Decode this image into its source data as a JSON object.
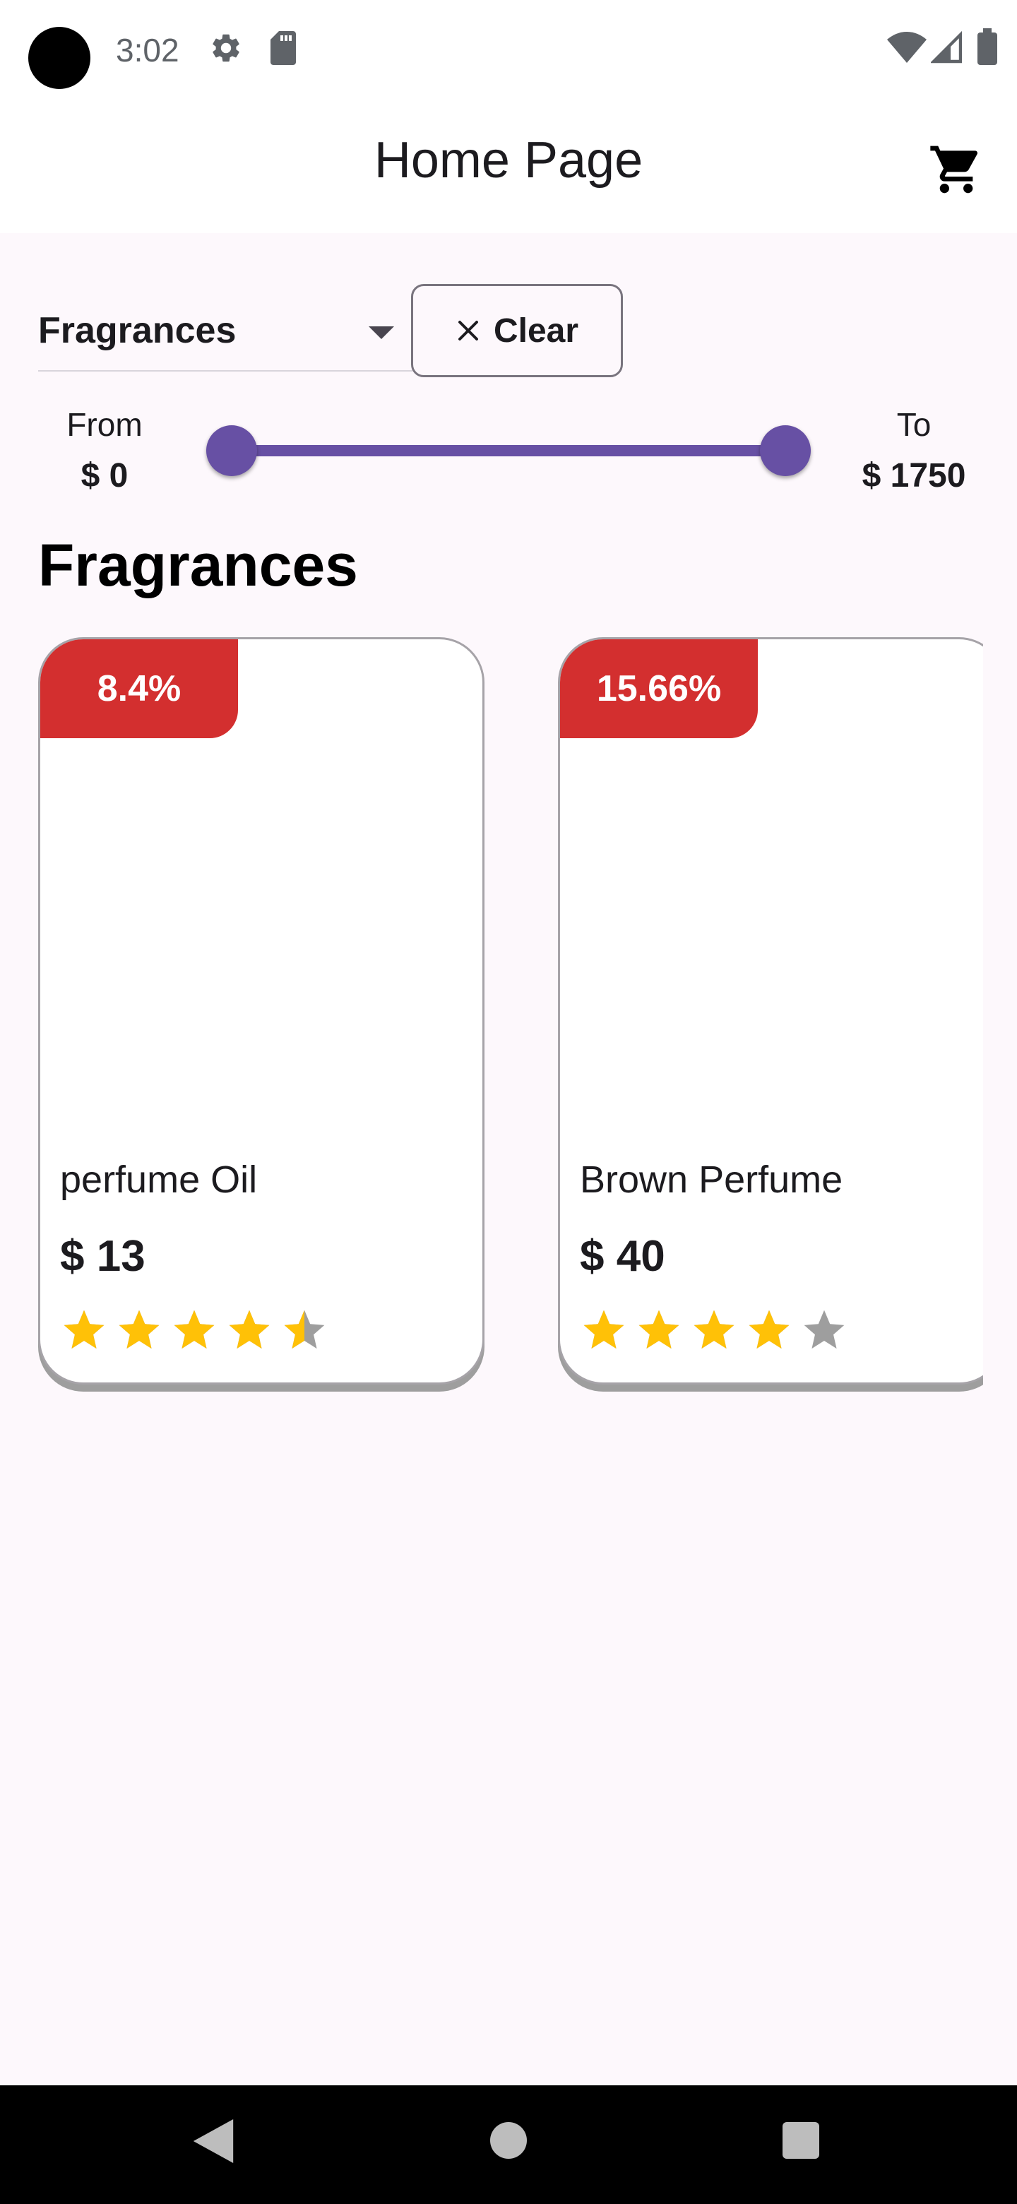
{
  "status_bar": {
    "time": "3:02",
    "icons": [
      "camera-cutout",
      "gear-icon",
      "sd-card-icon",
      "wifi-icon",
      "signal-icon",
      "battery-icon"
    ]
  },
  "app_bar": {
    "title": "Home Page",
    "cart_icon": "cart-icon"
  },
  "filters": {
    "category": {
      "selected": "Fragrances",
      "icon": "dropdown-arrow-icon"
    },
    "clear_button": {
      "label": "Clear",
      "icon": "close-icon"
    },
    "price_range": {
      "from_label": "From",
      "from_value": "$ 0",
      "to_label": "To",
      "to_value": "$ 1750",
      "slider_min_fraction": 0.0,
      "slider_max_fraction": 1.0
    }
  },
  "section": {
    "title": "Fragrances"
  },
  "products": [
    {
      "name": "perfume Oil",
      "price": "$ 13",
      "discount": "8.4%",
      "rating": 4.5
    },
    {
      "name": "Brown Perfume",
      "price": "$ 40",
      "discount": "15.66%",
      "rating": 4
    }
  ],
  "colors": {
    "accent": "#6750a4",
    "discount_badge": "#d32f2f",
    "star_filled": "#ffc107",
    "star_empty": "#9e9e9e",
    "background": "#fdf8fc"
  },
  "nav_bar": {
    "icons": [
      "back-icon",
      "home-icon",
      "recents-icon"
    ]
  }
}
